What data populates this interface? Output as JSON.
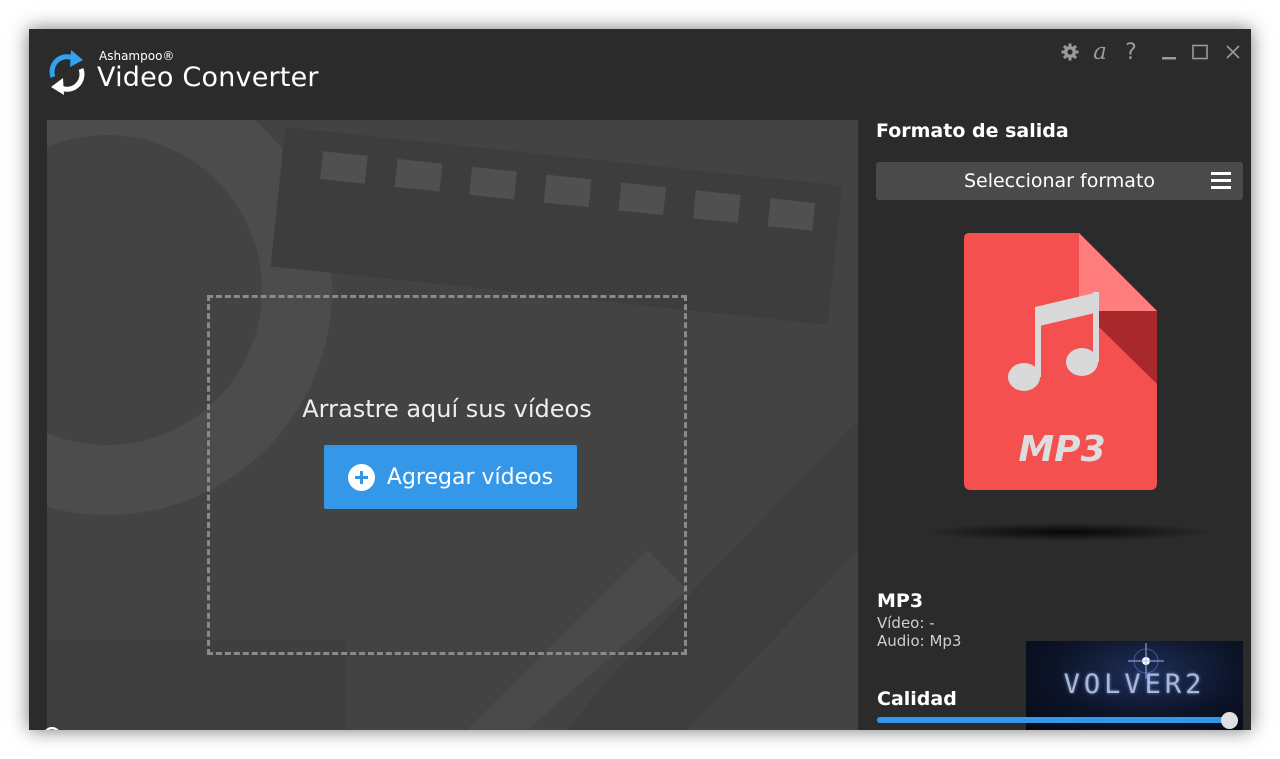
{
  "app": {
    "brand": "Ashampoo®",
    "title": "Video Converter"
  },
  "titlebar_icons": [
    "gear-icon",
    "ashampoo-a-icon",
    "help-icon",
    "minimize-icon",
    "maximize-icon",
    "close-icon"
  ],
  "drop_area": {
    "prompt": "Arrastre aquí sus vídeos",
    "add_button_label": "Agregar vídeos"
  },
  "output": {
    "section_title": "Formato de salida",
    "select_label": "Seleccionar formato",
    "file_icon_label": "MP3",
    "format_name": "MP3",
    "video_info": "Vídeo: -",
    "audio_info": "Audio: Mp3"
  },
  "quality": {
    "label": "Calidad",
    "value_fraction": 1.0
  },
  "watermark": "VOLVER2",
  "colors": {
    "accent": "#3497e8",
    "file_icon": "#f45050",
    "window_bg": "#2b2b2b"
  }
}
